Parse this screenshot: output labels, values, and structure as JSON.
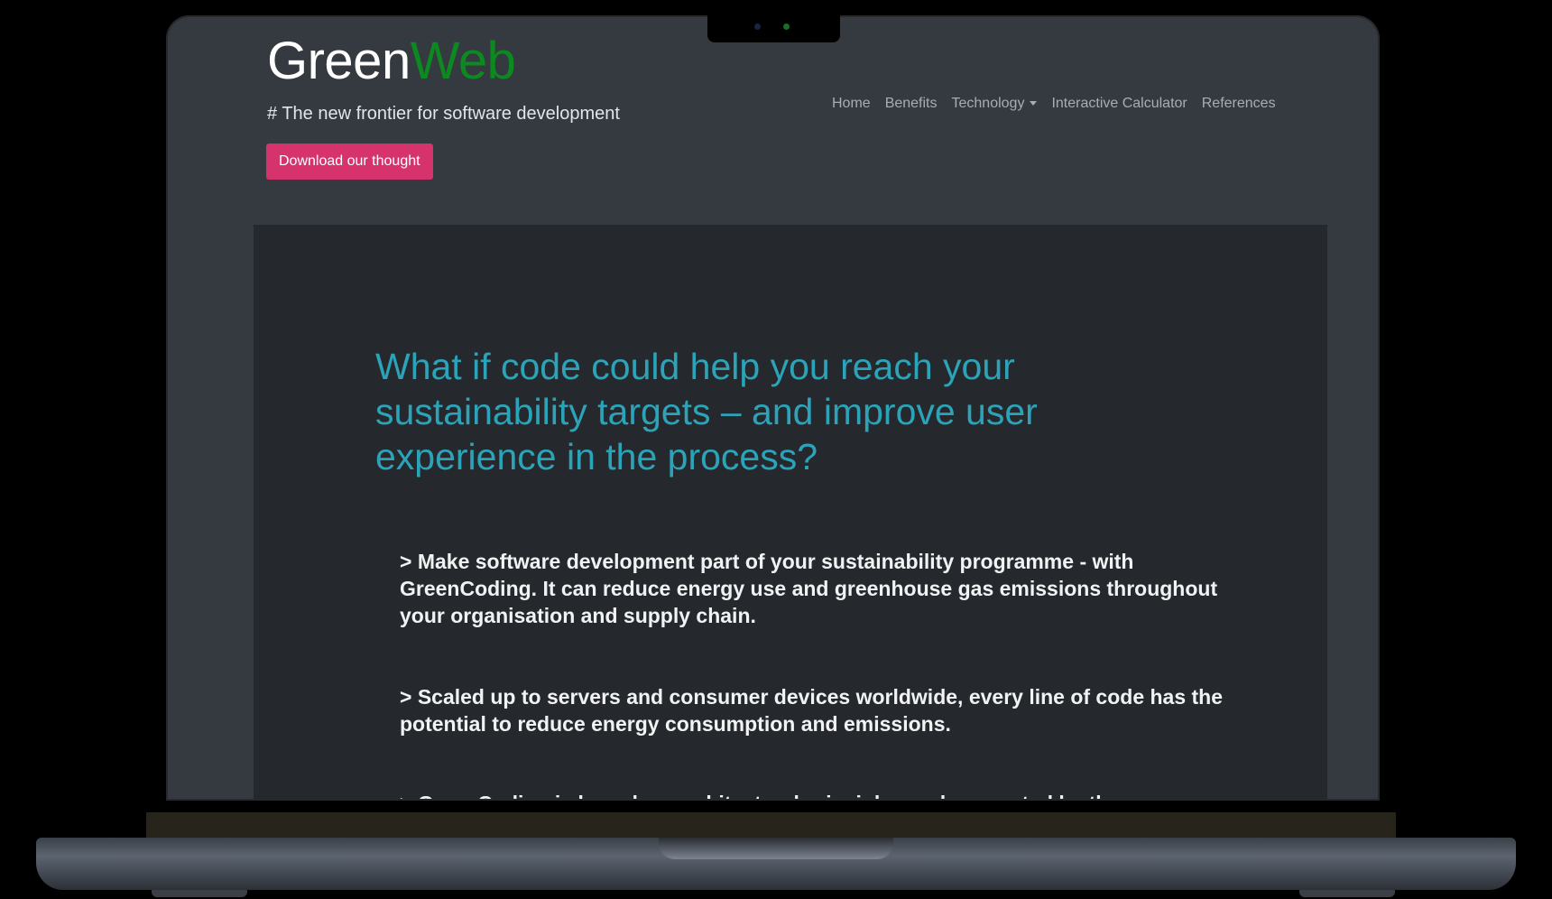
{
  "brand": {
    "part1": "Green",
    "part2": "Web",
    "accent_color": "#0d8a1f"
  },
  "hero": {
    "tagline": "# The new frontier for software development",
    "cta_label": "Download our thought",
    "cta_color": "#d6336c"
  },
  "nav": {
    "items": [
      {
        "label": "Home"
      },
      {
        "label": "Benefits"
      },
      {
        "label": "Technology",
        "has_dropdown": true
      },
      {
        "label": "Interactive Calculator"
      },
      {
        "label": "References"
      }
    ]
  },
  "content": {
    "headline": "What if code could help you reach your sustainability targets – and improve user experience in the process?",
    "headline_color": "#2ba3b8",
    "points": [
      "> Make software development part of your sustainability programme - with GreenCoding. It can reduce energy use and greenhouse gas emissions throughout your organisation and supply chain.",
      "> Scaled up to servers and consumer devices worldwide, every line of code has the potential to reduce energy consumption and emissions.",
      "> GreenCoding is based on architectural principles and supported by three"
    ]
  }
}
